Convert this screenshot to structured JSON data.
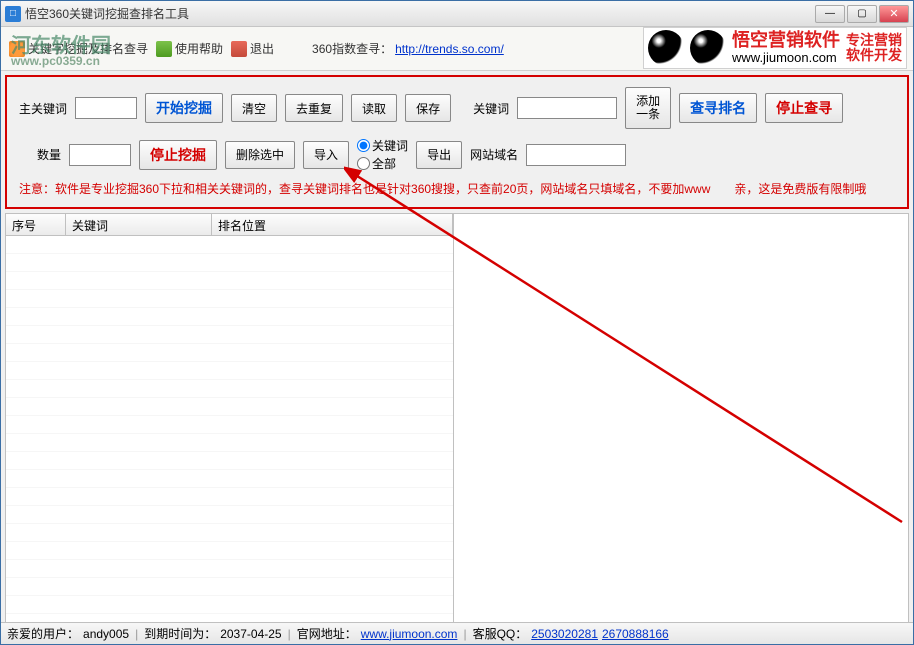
{
  "window": {
    "title": "悟空360关键词挖掘查排名工具"
  },
  "toolbar": {
    "item1": "关键字挖掘及排名查寻",
    "item2": "使用帮助",
    "item3": "退出",
    "index_label": "360指数查寻：",
    "index_link": "http://trends.so.com/"
  },
  "banner": {
    "brand": "悟空营销软件",
    "url": "www.jiumoon.com",
    "tag1": "专注营销",
    "tag2": "软件开发"
  },
  "watermark": {
    "main": "河东软件园",
    "sub": "www.pc0359.cn"
  },
  "panel": {
    "row1": {
      "main_kw_label": "主关键词",
      "start_btn": "开始挖掘",
      "clear_btn": "清空",
      "dedupe_btn": "去重复",
      "read_btn": "读取",
      "save_btn": "保存",
      "kw_label": "关键词",
      "add_btn": "添加\n一条",
      "search_rank_btn": "查寻排名",
      "stop_search_btn": "停止查寻"
    },
    "row2": {
      "count_label": "数量",
      "stop_btn": "停止挖掘",
      "del_sel_btn": "删除选中",
      "import_btn": "导入",
      "radio_kw": "关键词",
      "radio_all": "全部",
      "export_btn": "导出",
      "domain_label": "网站域名"
    },
    "notice": "注意：软件是专业挖掘360下拉和相关关键词的，查寻关键词排名也是针对360搜搜，只查前20页，网站域名只填域名，不要加www　　亲，这是免费版有限制哦"
  },
  "table": {
    "col1": "序号",
    "col2": "关键词",
    "col3": "排名位置"
  },
  "status": {
    "user_label": "亲爱的用户：",
    "user": "andy005",
    "expire_label": "到期时间为：",
    "expire": "2037-04-25",
    "site_label": "官网地址：",
    "site": "www.jiumoon.com",
    "qq_label": "客服QQ：",
    "qq1": "2503020281",
    "qq2": "2670888166"
  }
}
